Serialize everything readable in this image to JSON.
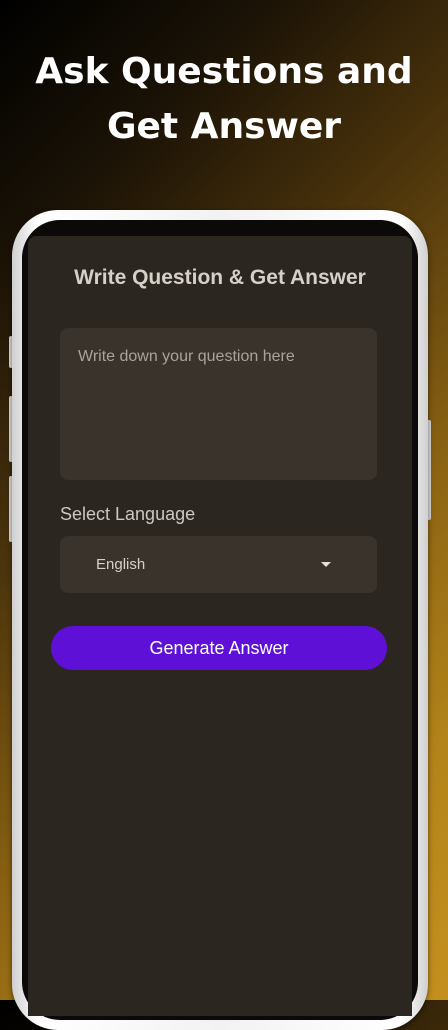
{
  "promo": {
    "headline_line1": "Ask Questions and",
    "headline_line2": "Get Answer"
  },
  "screen": {
    "title": "Write Question & Get Answer",
    "question_input": {
      "placeholder": "Write down your question here",
      "value": ""
    },
    "language": {
      "label": "Select Language",
      "selected": "English",
      "dropdown_icon": "caret-down-icon"
    },
    "generate_button_label": "Generate Answer"
  },
  "colors": {
    "accent": "#5e10d6",
    "screen_background": "#2c2620",
    "field_background": "#3a332c",
    "background_gradient_start": "#000000",
    "background_gradient_end": "#c4901f"
  }
}
